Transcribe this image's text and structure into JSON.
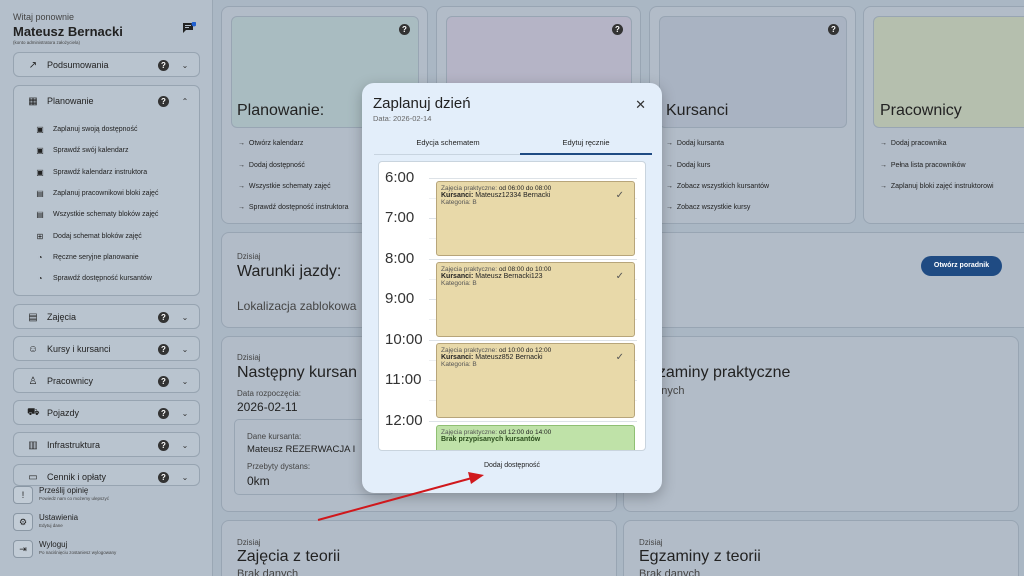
{
  "user": {
    "greeting": "Witaj ponownie",
    "name": "Mateusz Bernacki",
    "role": "(konto administratora założyciela)",
    "msg_badge": "0"
  },
  "sidebar": {
    "podsumowania": "Podsumowania",
    "planowanie": "Planowanie",
    "planowanie_items": [
      "Zaplanuj swoją dostępność",
      "Sprawdź swój kalendarz",
      "Sprawdź kalendarz instruktora",
      "Zaplanuj pracownikowi bloki zajęć",
      "Wszystkie schematy bloków zajęć",
      "Dodaj schemat bloków zajęć",
      "Ręczne seryjne planowanie",
      "Sprawdź dostępność kursantów"
    ],
    "sections": [
      "Zajęcia",
      "Kursy i kursanci",
      "Pracownicy",
      "Pojazdy",
      "Infrastruktura",
      "Cennik i opłaty"
    ],
    "footer": [
      {
        "title": "Prześlij opinię",
        "sub": "Powiedz nam co możemy ulepszyć"
      },
      {
        "title": "Ustawienia",
        "sub": "Edytuj dane"
      },
      {
        "title": "Wyloguj",
        "sub": "Po naciśnięciu zostaniesz wylogowany"
      }
    ]
  },
  "cards": {
    "planowanie": {
      "title": "Planowanie:",
      "links": [
        "Otwórz kalendarz",
        "Dodaj dostępność",
        "Wszystkie schematy zajęć",
        "Sprawdź dostępność instruktora"
      ]
    },
    "kursanci": {
      "title": "Kursanci",
      "links": [
        "Dodaj kursanta",
        "Dodaj kurs",
        "Zobacz wszystkich kursantów",
        "Zobacz wszystkie kursy"
      ]
    },
    "pracownicy": {
      "title": "Pracownicy",
      "links": [
        "Dodaj pracownika",
        "Pełna lista pracowników",
        "Zaplanuj bloki zajęć instruktorowi"
      ]
    },
    "warunki": {
      "today": "Dzisiaj",
      "title": "Warunki jazdy:",
      "location": "Lokalizacja zablokowa",
      "button": "Otwórz poradnik"
    },
    "nastepny": {
      "today": "Dzisiaj",
      "title": "Następny kursan",
      "start_label": "Data rozpoczęcia:",
      "start_value": "2026-02-11",
      "student_label": "Dane kursanta:",
      "student_value": "Mateusz REZERWACJA I",
      "distance_label": "Przebyty dystans:",
      "distance_value": "0km"
    },
    "egzaminy_prakt": {
      "title": "gzaminy praktyczne",
      "sub": "danych"
    },
    "teoria": {
      "today": "Dzisiaj",
      "title": "Zajęcia z teorii",
      "sub": "Brak danych"
    },
    "egzaminy_teoria": {
      "today": "Dzisiaj",
      "title": "Egzaminy z teorii",
      "sub": "Brak danych"
    }
  },
  "modal": {
    "title": "Zaplanuj dzień",
    "date": "Data: 2026-02-14",
    "tabs": [
      "Edycja schematem",
      "Edytuj ręcznie"
    ],
    "hours": [
      "6:00",
      "7:00",
      "8:00",
      "9:00",
      "10:00",
      "11:00",
      "12:00"
    ],
    "events": [
      {
        "prefix": "Zajęcia praktyczne: ",
        "time": "od 06:00 do 08:00",
        "student_label": "Kursanci: ",
        "student": "Mateusz12334 Bernacki",
        "category": "Kategoria: B"
      },
      {
        "prefix": "Zajęcia praktyczne: ",
        "time": "od 08:00 do 10:00",
        "student_label": "Kursanci: ",
        "student": "Mateusz Bernacki123",
        "category": "Kategoria: B"
      },
      {
        "prefix": "Zajęcia praktyczne: ",
        "time": "od 10:00 do 12:00",
        "student_label": "Kursanci: ",
        "student": "Mateusz852 Bernacki",
        "category": "Kategoria: B"
      },
      {
        "prefix": "Zajęcia praktyczne: ",
        "time": "od 12:00 do 14:00",
        "note": "Brak przypisanych kursantów"
      }
    ],
    "add_button": "Dodaj dostępność"
  },
  "colors": {
    "accent": "#1f4b83",
    "event_pending": "#e8d9a9",
    "event_free": "#bfe2a8",
    "arrow": "#d0181c"
  }
}
